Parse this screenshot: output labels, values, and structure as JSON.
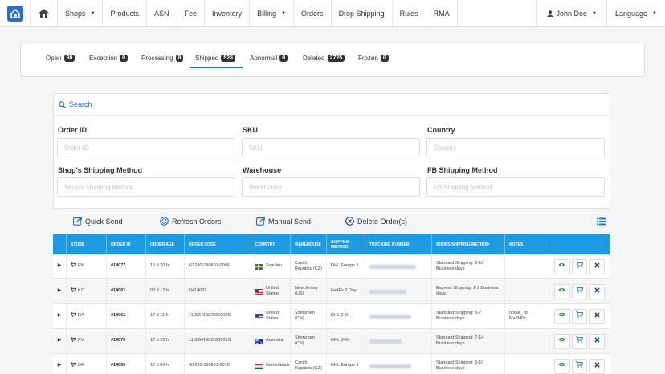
{
  "nav": {
    "items": [
      {
        "label": "Shops",
        "caret": true
      },
      {
        "label": "Products",
        "caret": false
      },
      {
        "label": "ASN",
        "caret": false
      },
      {
        "label": "Fee",
        "caret": false
      },
      {
        "label": "Inventory",
        "caret": false
      },
      {
        "label": "Billing",
        "caret": true
      },
      {
        "label": "Orders",
        "caret": false
      },
      {
        "label": "Drop Shipping",
        "caret": false
      },
      {
        "label": "Rules",
        "caret": false
      },
      {
        "label": "RMA",
        "caret": false
      }
    ],
    "user": "John Doe",
    "language": "Language"
  },
  "tabs": [
    {
      "label": "Open",
      "count": "30"
    },
    {
      "label": "Exception",
      "count": "0"
    },
    {
      "label": "Processing",
      "count": "8"
    },
    {
      "label": "Shipped",
      "count": "528",
      "active": true
    },
    {
      "label": "Abnormal",
      "count": "0"
    },
    {
      "label": "Deleted",
      "count": "2725"
    },
    {
      "label": "Frozen",
      "count": "0"
    }
  ],
  "search": {
    "title": "Search",
    "fields": {
      "order_id": {
        "label": "Order ID",
        "placeholder": "Order ID"
      },
      "sku": {
        "label": "SKU",
        "placeholder": "SKU"
      },
      "country": {
        "label": "Country",
        "placeholder": "Country"
      },
      "shop_shipping": {
        "label": "Shop's Shipping Method",
        "placeholder": "Shop's Shipping Method"
      },
      "warehouse": {
        "label": "Warehouse",
        "placeholder": "Warehouse"
      },
      "fb_shipping": {
        "label": "FB Shipping Method",
        "placeholder": "FB Shipping Method"
      }
    }
  },
  "actions": {
    "quick_send": "Quick Send",
    "refresh": "Refresh Orders",
    "manual_send": "Manual Send",
    "delete": "Delete Order(s)"
  },
  "table": {
    "headers": {
      "store": "STORE",
      "order_id": "ORDER ID",
      "order_age": "ORDER AGE",
      "order_code": "ORDER CODE",
      "country": "COUNTRY",
      "warehouse": "WAREHOUSE",
      "shipping": "SHIPPING METHOD",
      "tracking": "TRACKING NUMBER",
      "shops_shipping": "SHOPS SHIPPING METHOD",
      "notes": "NOTES"
    },
    "rows": [
      {
        "store": "PM",
        "order_id": "#14077",
        "age": "16 d 20 h",
        "code": "G1290-190801-0006",
        "country": "Sweden",
        "flag": "se",
        "warehouse": "Czech Republic (CZ)",
        "shipping": "DHL Europe 1",
        "shops_shipping": "Standard Shipping: 6-10 Business days",
        "notes": ""
      },
      {
        "store": "KC",
        "order_id": "#14061",
        "age": "00 d 12 h",
        "code": "D414061",
        "country": "United States",
        "flag": "us",
        "warehouse": "New Jersey (US)",
        "shipping": "FedEx 2 Day",
        "shops_shipping": "Express Shipping: 1-3 Business days",
        "notes": ""
      },
      {
        "store": "DA",
        "order_id": "#14061",
        "age": "17 d 11 h",
        "code": "1100641902260000S",
        "country": "United States",
        "flag": "us",
        "warehouse": "Shenzhen (CN)",
        "shipping": "DHL (HK)",
        "shops_shipping": "Standard Shipping: 5-7 Business days",
        "notes": "hotjar_ id: 6fe8bf0c"
      },
      {
        "store": "RV",
        "order_id": "#14070",
        "age": "17 d 20 h",
        "code": "1100641902260000S",
        "country": "Australia",
        "flag": "au",
        "warehouse": "Shenzhen (CN)",
        "shipping": "DHL (HK)",
        "shops_shipping": "Standard Shipping: 7-14 Business days",
        "notes": ""
      },
      {
        "store": "DA",
        "order_id": "#14069",
        "age": "17 d 04 h",
        "code": "G1290-190801-0016",
        "country": "Netherlands",
        "flag": "nl",
        "warehouse": "Czech Republic (CZ)",
        "shipping": "DHL Europe 1",
        "shops_shipping": "Standard Shipping: 6-10 Business days",
        "notes": ""
      }
    ]
  },
  "colors": {
    "accent": "#2a6fc9",
    "table_header": "#1e9ae0",
    "view_icon": "#2e9e46",
    "cart_icon": "#1e7fd0",
    "delete_icon": "#23416e"
  }
}
